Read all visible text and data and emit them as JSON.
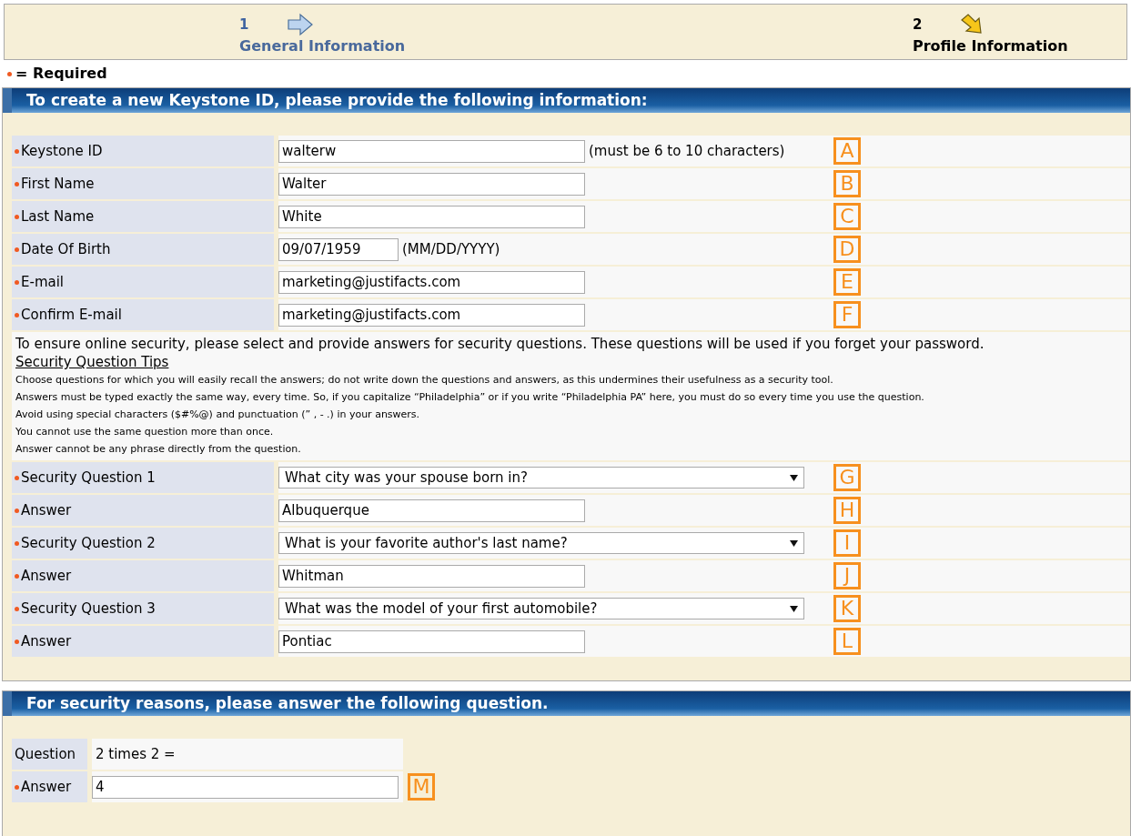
{
  "steps": [
    {
      "number": "1",
      "label": "General Information",
      "selected": false
    },
    {
      "number": "2",
      "label": "Profile Information",
      "selected": true
    }
  ],
  "required_legend": "= Required",
  "section1": {
    "title": "To create a new Keystone ID, please provide the following information:",
    "rows": [
      {
        "kind": "text",
        "label": "Keystone ID",
        "required": true,
        "value": "walterw",
        "hint": "(must be 6 to 10 characters)",
        "marker": "A"
      },
      {
        "kind": "text",
        "label": "First Name",
        "required": true,
        "value": "Walter",
        "marker": "B"
      },
      {
        "kind": "text",
        "label": "Last Name",
        "required": true,
        "value": "White",
        "marker": "C"
      },
      {
        "kind": "date",
        "label": "Date Of Birth",
        "required": true,
        "value": "09/07/1959",
        "hint": "(MM/DD/YYYY)",
        "marker": "D"
      },
      {
        "kind": "text",
        "label": "E-mail",
        "required": true,
        "value": "marketing@justifacts.com",
        "marker": "E"
      },
      {
        "kind": "text",
        "label": "Confirm E-mail",
        "required": true,
        "value": "marketing@justifacts.com",
        "marker": "F"
      },
      {
        "kind": "info",
        "intro": "To ensure online security, please select and provide answers for security questions. These questions will be used if you forget your password.",
        "link": "Security Question Tips",
        "tips": [
          "Choose questions for which you will easily recall the answers; do not write down the questions and answers, as this undermines their usefulness as a security tool.",
          "Answers must be typed exactly the same way, every time. So, if you capitalize “Philadelphia” or if you write “Philadelphia PA” here, you must do so every time you use the question.",
          "Avoid using special characters ($#%@) and punctuation (” , - .) in your answers.",
          "You cannot use the same question more than once.",
          "Answer cannot be any phrase directly from the question."
        ]
      },
      {
        "kind": "select",
        "label": "Security Question 1",
        "required": true,
        "value": "What city was your spouse born in?",
        "marker": "G"
      },
      {
        "kind": "text",
        "label": "Answer",
        "required": true,
        "value": "Albuquerque",
        "marker": "H"
      },
      {
        "kind": "select",
        "label": "Security Question 2",
        "required": true,
        "value": "What is your favorite author's last name?",
        "marker": "I"
      },
      {
        "kind": "text",
        "label": "Answer",
        "required": true,
        "value": "Whitman",
        "marker": "J"
      },
      {
        "kind": "select",
        "label": "Security Question 3",
        "required": true,
        "value": "What was the model of your first automobile?",
        "marker": "K"
      },
      {
        "kind": "text",
        "label": "Answer",
        "required": true,
        "value": "Pontiac",
        "marker": "L"
      }
    ]
  },
  "section2": {
    "title": "For security reasons, please answer the following question.",
    "rows": [
      {
        "kind": "static",
        "label": "Question",
        "required": false,
        "value": "2 times 2 ="
      },
      {
        "kind": "text",
        "label": "Answer",
        "required": true,
        "value": "4",
        "marker": "M"
      }
    ]
  }
}
